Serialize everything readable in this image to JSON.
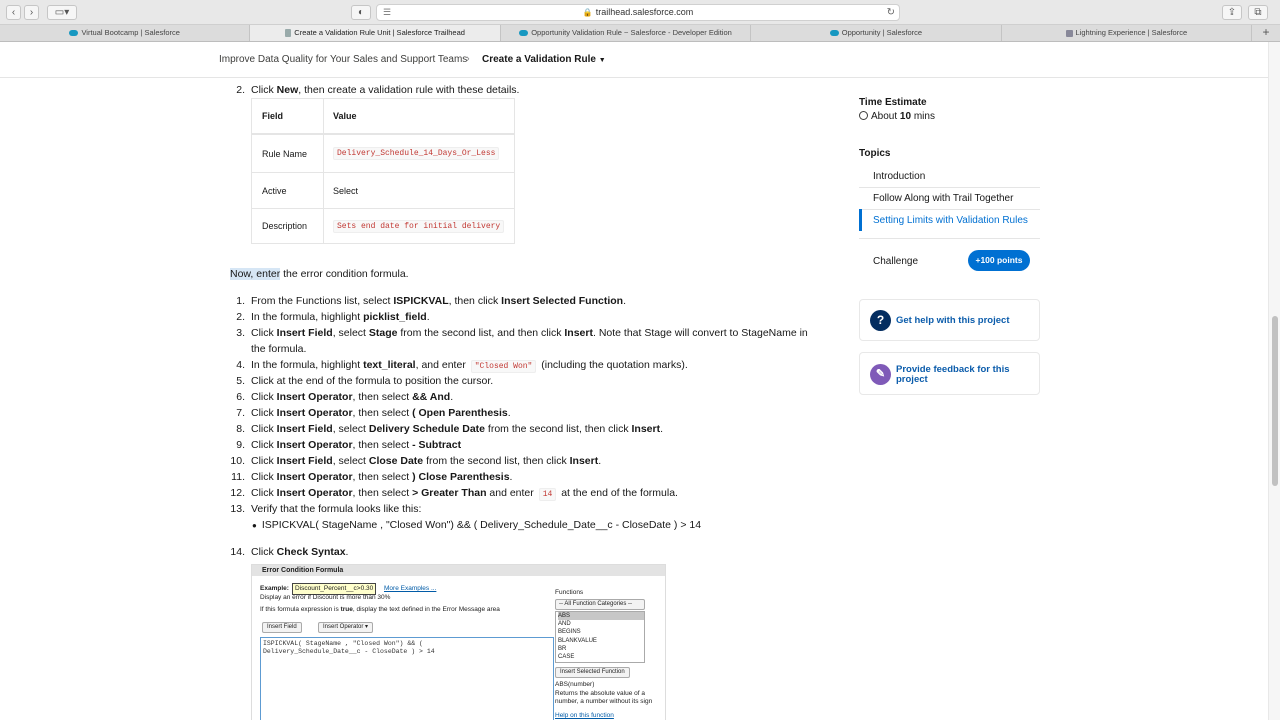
{
  "browser": {
    "url": "trailhead.salesforce.com",
    "tabs": [
      {
        "label": "Virtual Bootcamp | Salesforce"
      },
      {
        "label": "Create a Validation Rule Unit | Salesforce Trailhead"
      },
      {
        "label": "Opportunity Validation Rule ~ Salesforce - Developer Edition"
      },
      {
        "label": "Opportunity | Salesforce"
      },
      {
        "label": "Lightning Experience | Salesforce"
      }
    ],
    "new_tab": "+"
  },
  "breadcrumb": {
    "parent": "Improve Data Quality for Your Sales and Support Teams",
    "current": "Create a Validation Rule"
  },
  "content": {
    "step2_num": "2.",
    "step2_pre": "Click ",
    "step2_b": "New",
    "step2_post": ", then create a validation rule with these details.",
    "table": {
      "headers": [
        "Field",
        "Value"
      ],
      "rows": [
        {
          "field": "Rule Name",
          "value": "Delivery_Schedule_14_Days_Or_Less",
          "code": true
        },
        {
          "field": "Active",
          "value": "Select",
          "code": false
        },
        {
          "field": "Description",
          "value": "Sets end date for initial delivery",
          "code": true
        }
      ]
    },
    "intro_highlight": "Now, enter",
    "intro_rest": " the error condition formula.",
    "steps": [
      {
        "n": "1.",
        "parts": [
          [
            "From the Functions list, select ",
            false
          ],
          [
            "ISPICKVAL",
            true
          ],
          [
            ", then click ",
            false
          ],
          [
            "Insert Selected Function",
            true
          ],
          [
            ".",
            false
          ]
        ]
      },
      {
        "n": "2.",
        "parts": [
          [
            "In the formula, highlight ",
            false
          ],
          [
            "picklist_field",
            true
          ],
          [
            ".",
            false
          ]
        ]
      },
      {
        "n": "3.",
        "parts": [
          [
            "Click ",
            false
          ],
          [
            "Insert Field",
            true
          ],
          [
            ", select ",
            false
          ],
          [
            "Stage",
            true
          ],
          [
            " from the second list, and then click ",
            false
          ],
          [
            "Insert",
            true
          ],
          [
            ". Note that Stage will convert to StageName in",
            false
          ]
        ]
      },
      {
        "n": "",
        "parts": [
          [
            "the formula.",
            false
          ]
        ]
      },
      {
        "n": "4.",
        "parts": [
          [
            "In the formula, highlight ",
            false
          ],
          [
            "text_literal",
            true
          ],
          [
            ", and enter ",
            false
          ],
          [
            "CODE:\"Closed Won\"",
            false
          ],
          [
            " (including the quotation marks).",
            false
          ]
        ]
      },
      {
        "n": "5.",
        "parts": [
          [
            "Click at the end of the formula to position the cursor.",
            false
          ]
        ]
      },
      {
        "n": "6.",
        "parts": [
          [
            "Click ",
            false
          ],
          [
            "Insert Operator",
            true
          ],
          [
            ", then select ",
            false
          ],
          [
            "&& And",
            true
          ],
          [
            ".",
            false
          ]
        ]
      },
      {
        "n": "7.",
        "parts": [
          [
            "Click ",
            false
          ],
          [
            "Insert Operator",
            true
          ],
          [
            ", then select ",
            false
          ],
          [
            "( Open Parenthesis",
            true
          ],
          [
            ".",
            false
          ]
        ]
      },
      {
        "n": "8.",
        "parts": [
          [
            "Click ",
            false
          ],
          [
            "Insert Field",
            true
          ],
          [
            ", select ",
            false
          ],
          [
            "Delivery Schedule Date",
            true
          ],
          [
            " from the second list, then click ",
            false
          ],
          [
            "Insert",
            true
          ],
          [
            ".",
            false
          ]
        ]
      },
      {
        "n": "9.",
        "parts": [
          [
            "Click ",
            false
          ],
          [
            "Insert Operator",
            true
          ],
          [
            ", then select ",
            false
          ],
          [
            "- Subtract",
            true
          ]
        ]
      },
      {
        "n": "10.",
        "parts": [
          [
            "Click ",
            false
          ],
          [
            "Insert Field",
            true
          ],
          [
            ", select ",
            false
          ],
          [
            "Close Date",
            true
          ],
          [
            " from the second list, then click ",
            false
          ],
          [
            "Insert",
            true
          ],
          [
            ".",
            false
          ]
        ]
      },
      {
        "n": "11.",
        "parts": [
          [
            "Click ",
            false
          ],
          [
            "Insert Operator",
            true
          ],
          [
            ", then select ",
            false
          ],
          [
            ") Close Parenthesis",
            true
          ],
          [
            ".",
            false
          ]
        ]
      },
      {
        "n": "12.",
        "parts": [
          [
            "Click ",
            false
          ],
          [
            "Insert Operator",
            true
          ],
          [
            ", then select ",
            false
          ],
          [
            "> Greater Than",
            true
          ],
          [
            " and enter ",
            false
          ],
          [
            "CODE:14",
            false
          ],
          [
            " at the end of the formula.",
            false
          ]
        ]
      },
      {
        "n": "13.",
        "parts": [
          [
            "Verify that the formula looks like this:",
            false
          ]
        ]
      }
    ],
    "formula_bullet": "ISPICKVAL( StageName , \"Closed Won\") && ( Delivery_Schedule_Date__c - CloseDate ) > 14",
    "step14_num": "14.",
    "step14_pre": "Click ",
    "step14_b": "Check Syntax",
    "step14_post": "."
  },
  "error_formula": {
    "title": "Error Condition Formula",
    "example_label": "Example:",
    "example_value": "Discount_Percent__c>0.30",
    "more_examples": "More Examples ...",
    "hint1": "Display an error if Discount is more than 30%",
    "hint2_pre": "If this formula expression is ",
    "hint2_b": "true",
    "hint2_post": ", display the text defined in the Error Message area",
    "insert_field": "Insert Field",
    "insert_operator": "Insert Operator",
    "formula_line1": "ISPICKVAL( StageName , \"Closed Won\") && (",
    "formula_line2": "Delivery_Schedule_Date__c - CloseDate ) > 14",
    "functions_label": "Functions",
    "functions_select": "-- All Function Categories --",
    "functions_list": [
      "ABS",
      "AND",
      "BEGINS",
      "BLANKVALUE",
      "BR",
      "CASE"
    ],
    "insert_selected_function": "Insert Selected Function",
    "abs_sig": "ABS(number)",
    "abs_desc1": "Returns the absolute value of a",
    "abs_desc2": "number, a number without its sign",
    "help_link": "Help on this function"
  },
  "sidebar": {
    "time_label": "Time Estimate",
    "time_pre": "About ",
    "time_b": "10",
    "time_post": " mins",
    "topics_label": "Topics",
    "topics": [
      "Introduction",
      "Follow Along with Trail Together",
      "Setting Limits with Validation Rules"
    ],
    "challenge": "Challenge",
    "points": "+100 points",
    "help_text": "Get help with this project",
    "feedback_line1": "Provide feedback for this",
    "feedback_line2": "project"
  },
  "colors": {
    "accent": "#0070d2",
    "link": "#0b5cab",
    "help_icon": "#032d60",
    "feedback_icon": "#7f5ab8",
    "code": "#c23934"
  }
}
